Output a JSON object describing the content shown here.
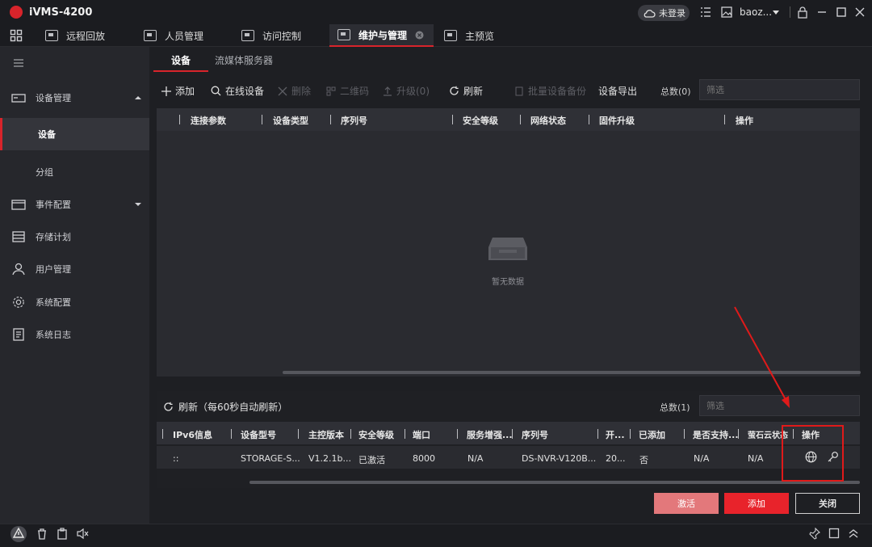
{
  "app": {
    "title": "iVMS-4200",
    "login_status": "未登录",
    "user": "baoz..."
  },
  "top_tabs": [
    {
      "label": "远程回放"
    },
    {
      "label": "人员管理"
    },
    {
      "label": "访问控制"
    },
    {
      "label": "维护与管理",
      "active": true
    },
    {
      "label": "主预览"
    }
  ],
  "sidebar": {
    "items": [
      {
        "label": "设备管理"
      },
      {
        "label": "设备"
      },
      {
        "label": "分组"
      },
      {
        "label": "事件配置"
      },
      {
        "label": "存储计划"
      },
      {
        "label": "用户管理"
      },
      {
        "label": "系统配置"
      },
      {
        "label": "系统日志"
      }
    ]
  },
  "subtabs": {
    "device": "设备",
    "stream": "流媒体服务器"
  },
  "toolbar": {
    "add": "添加",
    "online": "在线设备",
    "delete": "删除",
    "qrcode": "二维码",
    "upgrade": "升级(0)",
    "refresh": "刷新",
    "backup": "批量设备备份",
    "export": "设备导出",
    "total": "总数(0)",
    "filter_placeholder": "筛选"
  },
  "table1": {
    "headers": [
      "连接参数",
      "设备类型",
      "序列号",
      "安全等级",
      "网络状态",
      "固件升级",
      "操作"
    ],
    "empty": "暂无数据"
  },
  "lower": {
    "refresh": "刷新（每60秒自动刷新）",
    "total": "总数(1)",
    "filter_placeholder": "筛选",
    "headers": [
      "IPv6信息",
      "设备型号",
      "主控版本",
      "安全等级",
      "端口",
      "服务增强...",
      "序列号",
      "开...",
      "已添加",
      "是否支持...",
      "萤石云状态",
      "操作"
    ],
    "row": [
      "::",
      "STORAGE-S...",
      "V1.2.1b...",
      "已激活",
      "8000",
      "N/A",
      "DS-NVR-V120B...",
      "20...",
      "否",
      "N/A",
      "N/A"
    ]
  },
  "buttons": {
    "activate": "激活",
    "add": "添加",
    "close": "关闭"
  },
  "colors": {
    "accent": "#d8242b",
    "activate_bg": "#e3787b",
    "highlight": "#e01a1a"
  }
}
